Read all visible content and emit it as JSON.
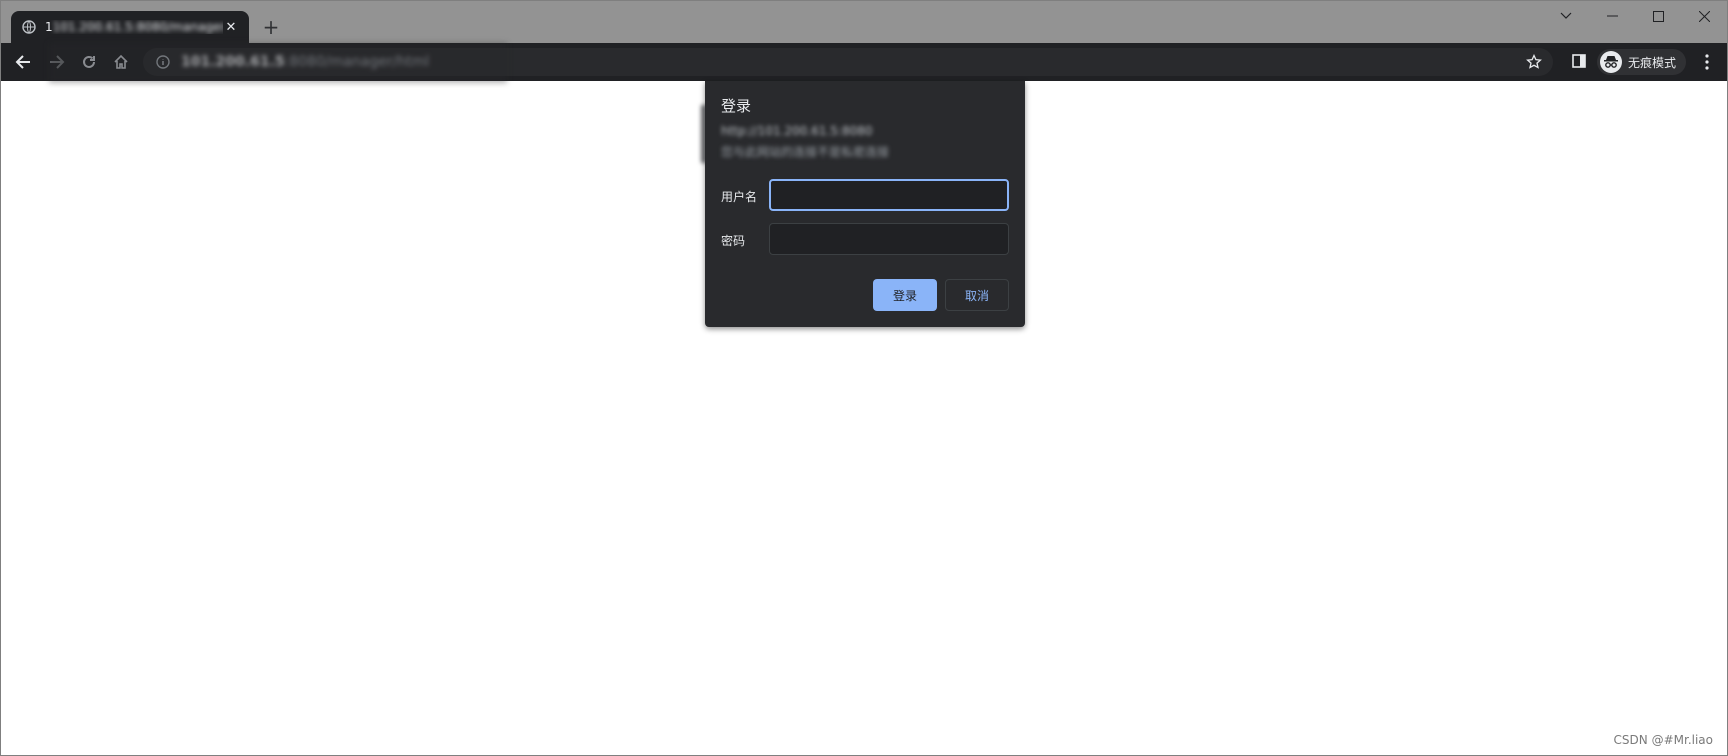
{
  "browser": {
    "tab": {
      "title": "101.200.61.5:8080/manager/h",
      "title_first_char": "1"
    },
    "omnibox": {
      "host": "101.200.61.5",
      "path": ":8080/manager/html"
    },
    "incognito_label": "无痕模式",
    "icons": {
      "tab_favicon": "globe-icon",
      "tab_close": "close-icon",
      "new_tab": "plus-icon",
      "back": "arrow-left-icon",
      "forward": "arrow-right-icon",
      "reload": "reload-icon",
      "home": "home-icon",
      "site_info": "info-icon",
      "bookmark": "star-icon",
      "side_panel": "side-panel-icon",
      "incognito": "incognito-icon",
      "menu": "kebab-menu-icon",
      "tab_search": "chevron-down-icon",
      "minimize": "minimize-icon",
      "maximize": "maximize-icon",
      "window_close": "close-icon"
    }
  },
  "dialog": {
    "title": "登录",
    "url": "http://101.200.61.5:8080",
    "warning": "您与此网站的连接不是私密连接",
    "username_label": "用户名",
    "username_value": "",
    "password_label": "密码",
    "password_value": "",
    "login_button": "登录",
    "cancel_button": "取消"
  },
  "watermark": "CSDN @#Mr.liao",
  "colors": {
    "titlebar": "#939393",
    "toolbar": "#202124",
    "dialog_bg": "#292a2d",
    "accent": "#8ab4f8"
  }
}
